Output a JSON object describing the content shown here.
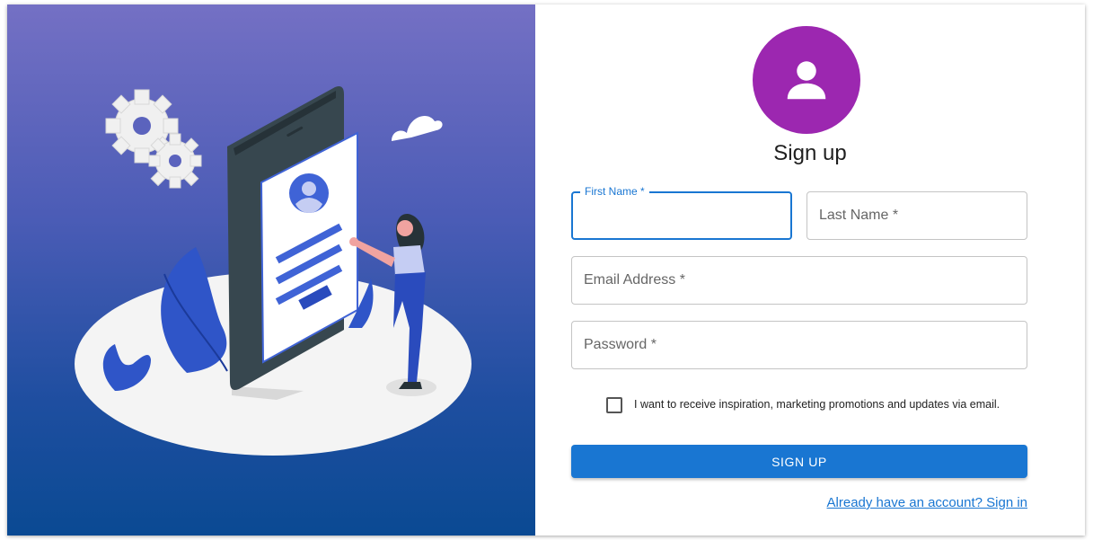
{
  "form": {
    "title": "Sign up",
    "first_name": {
      "label": "First Name",
      "required_mark": "*",
      "value": ""
    },
    "last_name": {
      "label": "Last Name",
      "required_mark": "*",
      "value": ""
    },
    "email": {
      "label": "Email Address",
      "required_mark": "*",
      "value": ""
    },
    "password": {
      "label": "Password",
      "required_mark": "*",
      "value": ""
    },
    "marketing_checkbox": {
      "label": "I want to receive inspiration, marketing promotions and updates via email.",
      "checked": false
    },
    "submit_label": "SIGN UP",
    "signin_link": "Already have an account? Sign in"
  },
  "icons": {
    "avatar": "person-icon",
    "illustration": "signup-illustration"
  },
  "colors": {
    "primary": "#1976d2",
    "avatar_bg": "#9c27b0",
    "hero_top": "#7470c4",
    "hero_bottom": "#0a4a93"
  }
}
